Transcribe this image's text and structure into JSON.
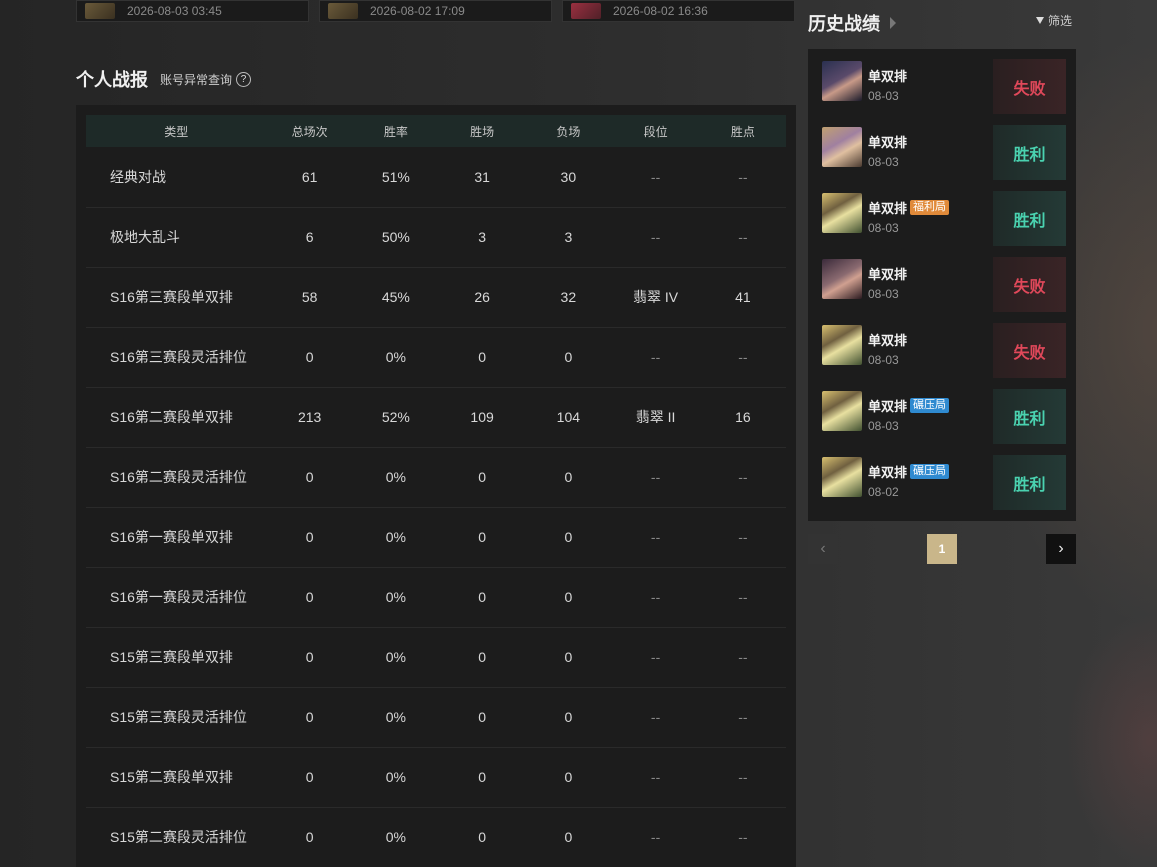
{
  "recent_cards": [
    {
      "date": "2026-08-03 03:45"
    },
    {
      "date": "2026-08-02 17:09"
    },
    {
      "date": "2026-08-02 16:36"
    }
  ],
  "stats": {
    "title": "个人战报",
    "account_check": "账号异常查询",
    "help_icon": "?",
    "headers": [
      "类型",
      "总场次",
      "胜率",
      "胜场",
      "负场",
      "段位",
      "胜点"
    ],
    "rows": [
      [
        "经典对战",
        "61",
        "51%",
        "31",
        "30",
        "--",
        "--"
      ],
      [
        "极地大乱斗",
        "6",
        "50%",
        "3",
        "3",
        "--",
        "--"
      ],
      [
        "S16第三赛段单双排",
        "58",
        "45%",
        "26",
        "32",
        "翡翠 IV",
        "41"
      ],
      [
        "S16第三赛段灵活排位",
        "0",
        "0%",
        "0",
        "0",
        "--",
        "--"
      ],
      [
        "S16第二赛段单双排",
        "213",
        "52%",
        "109",
        "104",
        "翡翠 II",
        "16"
      ],
      [
        "S16第二赛段灵活排位",
        "0",
        "0%",
        "0",
        "0",
        "--",
        "--"
      ],
      [
        "S16第一赛段单双排",
        "0",
        "0%",
        "0",
        "0",
        "--",
        "--"
      ],
      [
        "S16第一赛段灵活排位",
        "0",
        "0%",
        "0",
        "0",
        "--",
        "--"
      ],
      [
        "S15第三赛段单双排",
        "0",
        "0%",
        "0",
        "0",
        "--",
        "--"
      ],
      [
        "S15第三赛段灵活排位",
        "0",
        "0%",
        "0",
        "0",
        "--",
        "--"
      ],
      [
        "S15第二赛段单双排",
        "0",
        "0%",
        "0",
        "0",
        "--",
        "--"
      ],
      [
        "S15第二赛段灵活排位",
        "0",
        "0%",
        "0",
        "0",
        "--",
        "--"
      ]
    ]
  },
  "history": {
    "title": "历史战绩",
    "filter_label": "筛选",
    "matches": [
      {
        "mode": "单双排",
        "badge": "",
        "date": "08-03",
        "result": "失败",
        "outcome": "lose",
        "avatar": "a"
      },
      {
        "mode": "单双排",
        "badge": "",
        "date": "08-03",
        "result": "胜利",
        "outcome": "win",
        "avatar": "b"
      },
      {
        "mode": "单双排",
        "badge": "福利局",
        "badge_color": "orange",
        "date": "08-03",
        "result": "胜利",
        "outcome": "win",
        "avatar": "c"
      },
      {
        "mode": "单双排",
        "badge": "",
        "date": "08-03",
        "result": "失败",
        "outcome": "lose",
        "avatar": "d"
      },
      {
        "mode": "单双排",
        "badge": "",
        "date": "08-03",
        "result": "失败",
        "outcome": "lose",
        "avatar": "c"
      },
      {
        "mode": "单双排",
        "badge": "碾压局",
        "badge_color": "blue",
        "date": "08-03",
        "result": "胜利",
        "outcome": "win",
        "avatar": "c"
      },
      {
        "mode": "单双排",
        "badge": "碾压局",
        "badge_color": "blue",
        "date": "08-02",
        "result": "胜利",
        "outcome": "win",
        "avatar": "c"
      }
    ]
  },
  "pagination": {
    "current_page": "1",
    "prev": "‹",
    "next": "›"
  }
}
